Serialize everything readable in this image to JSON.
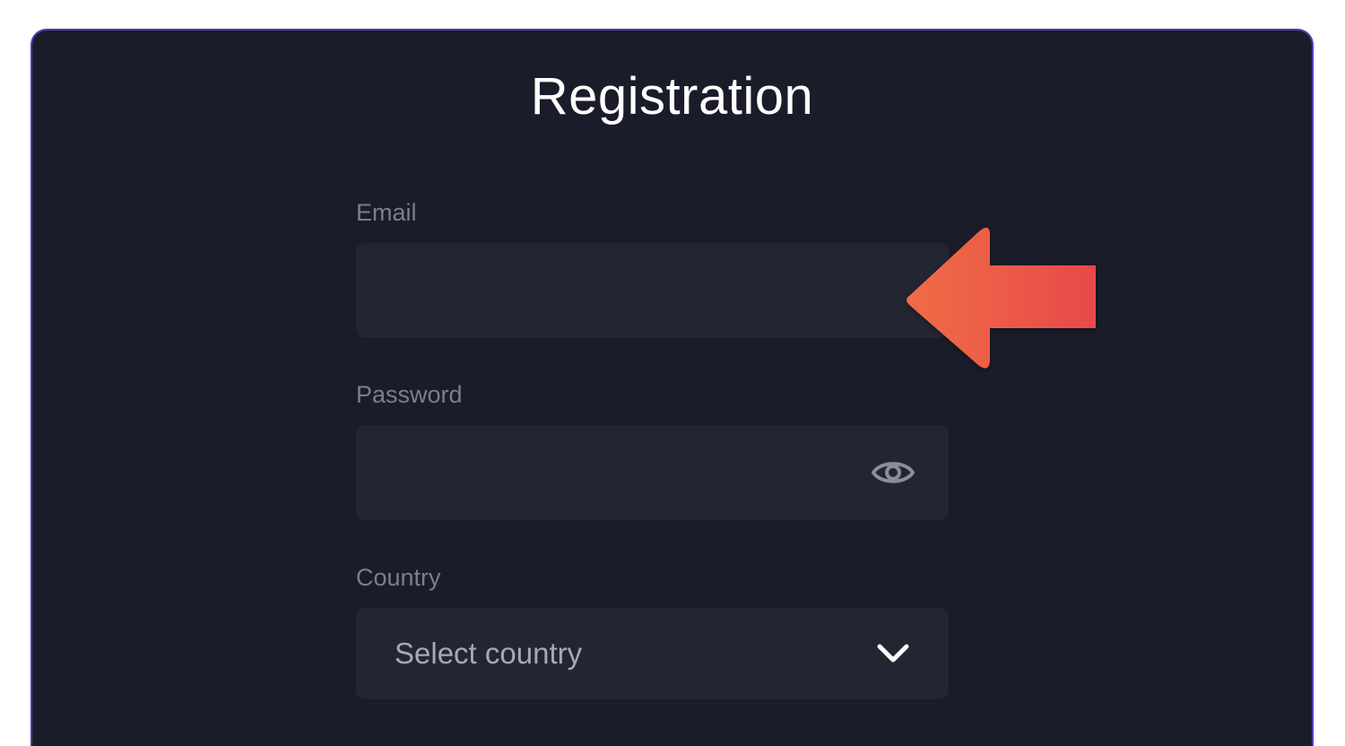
{
  "form": {
    "title": "Registration",
    "email": {
      "label": "Email",
      "value": ""
    },
    "password": {
      "label": "Password",
      "value": ""
    },
    "country": {
      "label": "Country",
      "selected": "Select country"
    }
  },
  "icons": {
    "password_toggle": "eye-icon",
    "country_dropdown": "chevron-down-icon",
    "annotation": "arrow-left-icon"
  },
  "colors": {
    "panel_background": "#1b1c29",
    "panel_border": "#4b3fb8",
    "field_background": "#242533",
    "label_text": "#7c7e8d",
    "arrow_start": "#ef6d45",
    "arrow_end": "#e8494a"
  }
}
